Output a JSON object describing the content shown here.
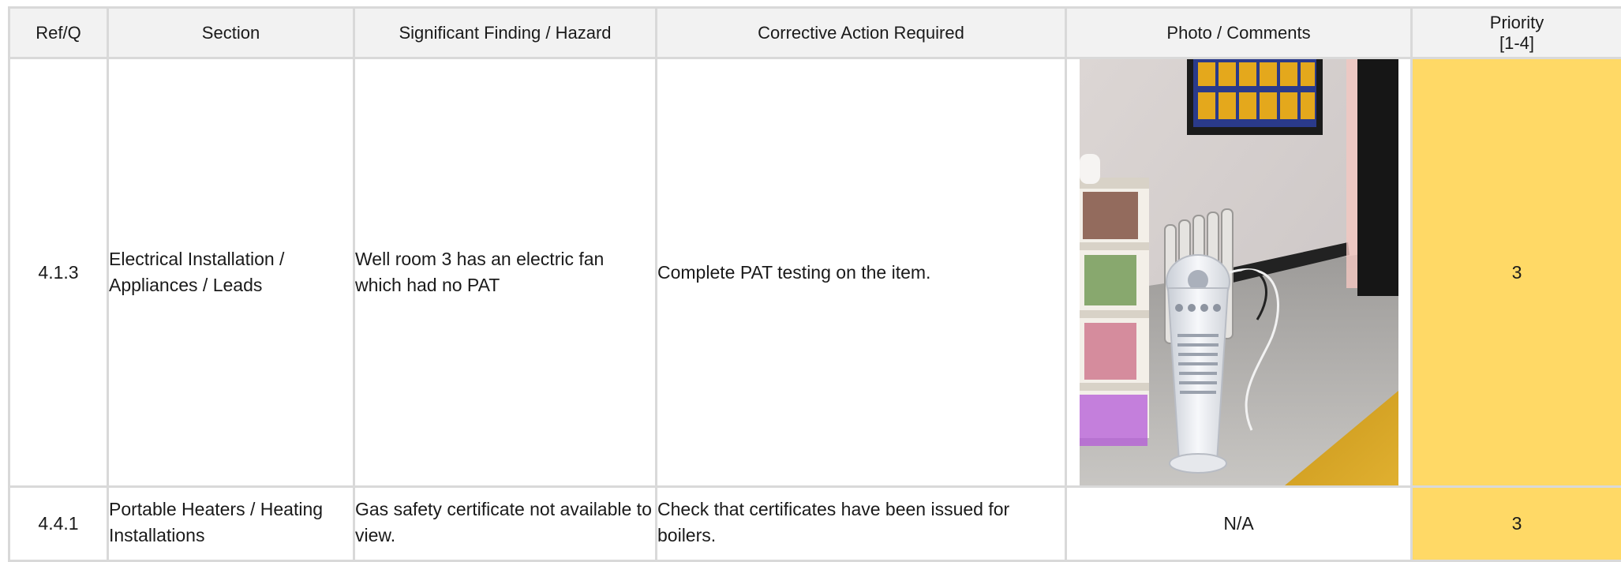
{
  "table": {
    "headers": {
      "ref": "Ref/Q",
      "section": "Section",
      "finding": "Significant Finding / Hazard",
      "action": "Corrective Action Required",
      "photo": "Photo / Comments",
      "priority_line1": "Priority",
      "priority_line2": "[1-4]"
    },
    "rows": [
      {
        "ref": "4.1.3",
        "section": "Electrical Installation / Appliances / Leads",
        "finding": "Well room 3 has an electric fan which had no PAT",
        "action": "Complete PAT testing on the item.",
        "photo_comment": "",
        "priority": "3"
      },
      {
        "ref": "4.4.1",
        "section": "Portable Heaters / Heating Installations",
        "finding": "Gas safety certificate not available to view.",
        "action": "Check that certificates have been issued for boilers.",
        "photo_comment": "N/A",
        "priority": "3"
      }
    ]
  },
  "colors": {
    "header_bg": "#f2f2f2",
    "grid": "#d9d9d9",
    "priority_bg": "#ffd966"
  }
}
